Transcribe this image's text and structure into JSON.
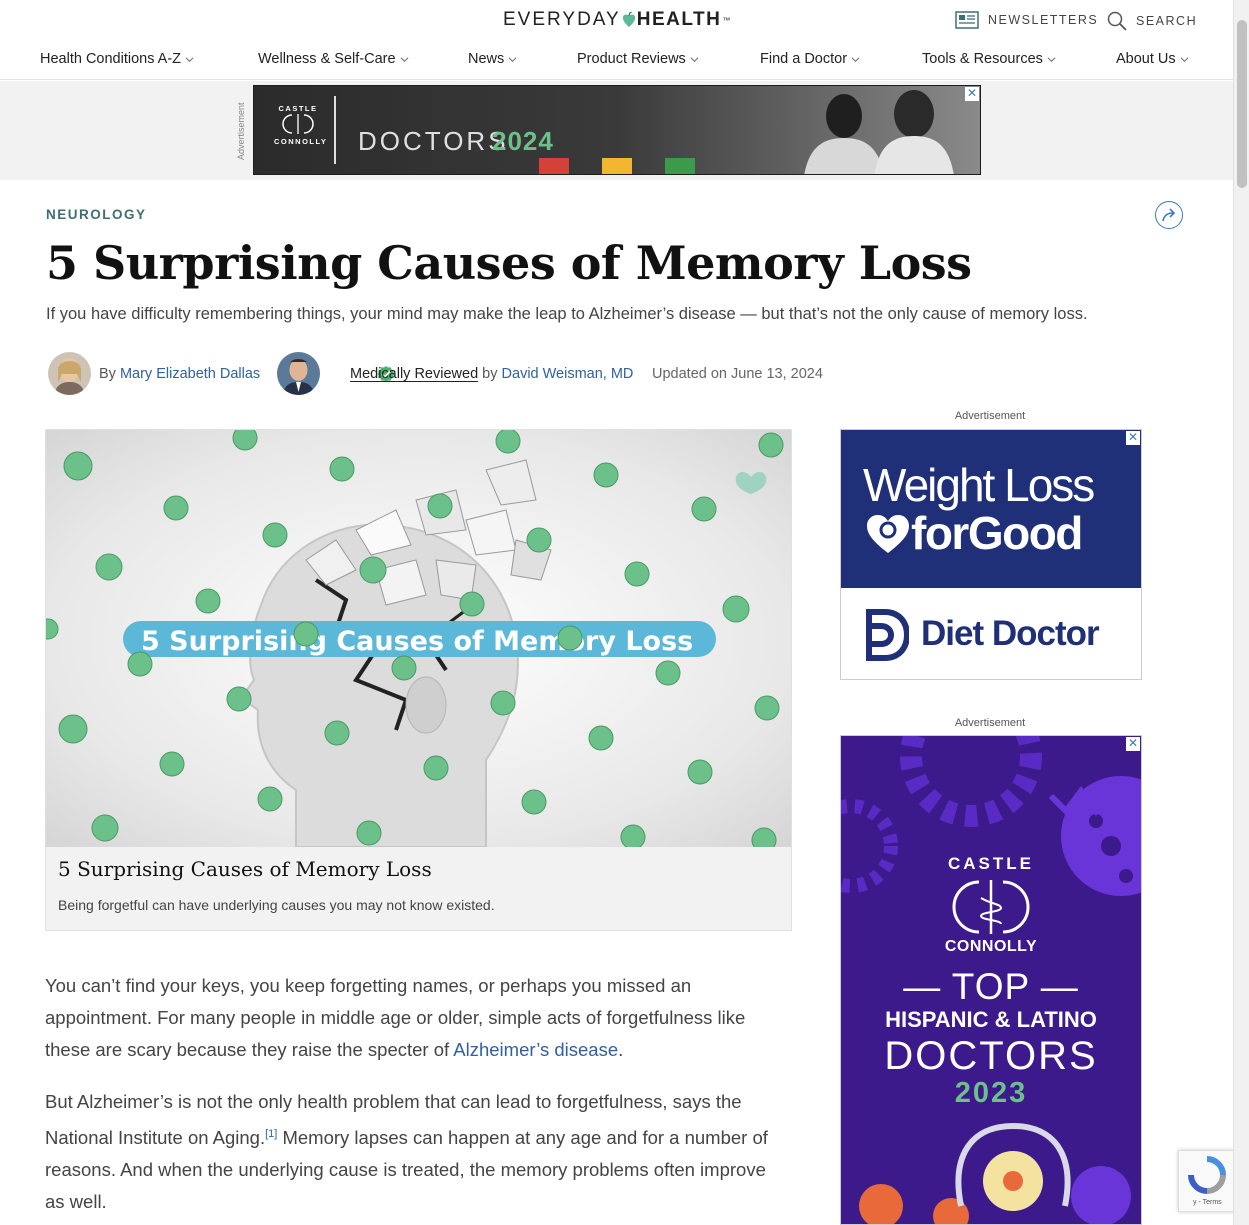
{
  "header": {
    "logo_part1": "EVERYDAY",
    "logo_part2": "HEALTH",
    "newsletters_label": "NEWSLETTERS",
    "search_label": "SEARCH",
    "nav": [
      {
        "label": "Health Conditions A-Z"
      },
      {
        "label": "Wellness & Self-Care"
      },
      {
        "label": "News"
      },
      {
        "label": "Product Reviews"
      },
      {
        "label": "Find a Doctor"
      },
      {
        "label": "Tools & Resources"
      },
      {
        "label": "About Us"
      }
    ]
  },
  "top_ad": {
    "side_label": "Advertisement",
    "brand_line1": "CASTLE",
    "brand_line2": "CONNOLLY",
    "doctors_word": "DOCTORS",
    "year": "2024",
    "close": "✕"
  },
  "article": {
    "category": "NEUROLOGY",
    "title": "5 Surprising Causes of Memory Loss",
    "subtitle": "If you have difficulty remembering things, your mind may make the leap to Alzheimer’s disease — but that’s not the only cause of memory loss.",
    "byline": {
      "by": "By",
      "author": "Mary Elizabeth Dallas",
      "medically_reviewed": "Medically Reviewed",
      "by2": "by",
      "reviewer": "David Weisman, MD",
      "updated": "Updated on June 13, 2024"
    },
    "media": {
      "overlay_text": "5 Surprising Causes of Memory Loss",
      "caption_title": "5 Surprising Causes of Memory Loss",
      "caption_desc": "Being forgetful can have underlying causes you may not know existed."
    },
    "para1_a": "You can’t find your keys, you keep forgetting names, or perhaps you missed an appointment. For many people in middle age or older, simple acts of forgetfulness like these are scary because they raise the specter of ",
    "para1_link": "Alzheimer’s disease",
    "para1_b": ".",
    "para2_a": "But Alzheimer’s is not the only health problem that can lead to forgetfulness, says the National Institute on Aging.",
    "para2_sup": "[1]",
    "para2_b": " Memory lapses can happen at any age and for a number of reasons. And when the underlying cause is treated, the memory problems often improve as well."
  },
  "side_ads": {
    "label1": "Advertisement",
    "wl_line1": "Weight Loss",
    "wl_line2": "forGood",
    "dd_name": "Diet Doctor",
    "label2": "Advertisement",
    "cc_castle": "CASTLE",
    "cc_connolly": "CONNOLLY",
    "cc_top": "— TOP —",
    "cc_hisp": "HISPANIC & LATINO",
    "cc_doctors": "DOCTORS",
    "cc_year": "2023",
    "close": "✕"
  },
  "recaptcha": {
    "terms": "y - Terms"
  },
  "colors": {
    "accent_link": "#2f5fa5",
    "category": "#3e6f72",
    "green_dot": "#6cc18a",
    "navy_ad": "#1f2f78",
    "purple_ad": "#3c1a8c"
  }
}
